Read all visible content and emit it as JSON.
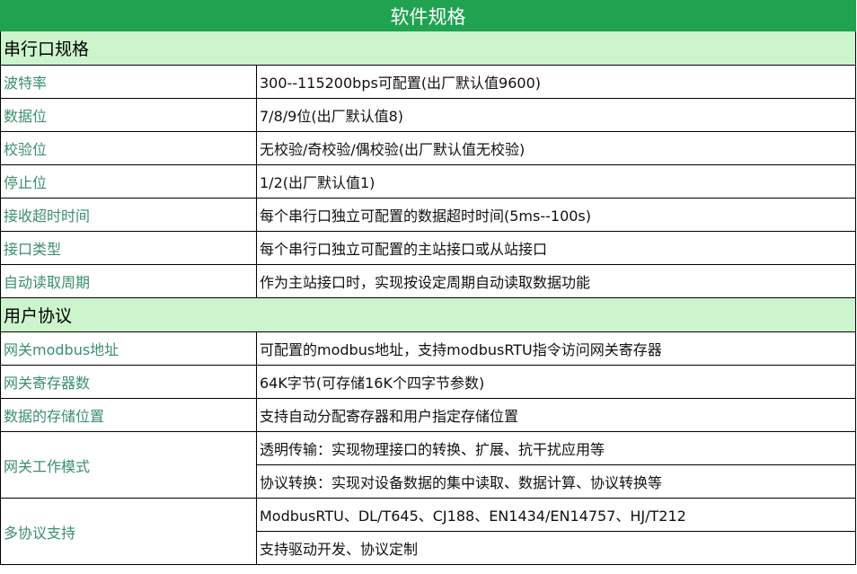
{
  "title": "软件规格",
  "sections": [
    {
      "name": "串行口规格",
      "rows": [
        {
          "label": "波特率",
          "values": [
            "300--115200bps可配置(出厂默认值9600)"
          ]
        },
        {
          "label": "数据位",
          "values": [
            "7/8/9位(出厂默认值8)"
          ]
        },
        {
          "label": "校验位",
          "values": [
            "无校验/奇校验/偶校验(出厂默认值无校验)"
          ]
        },
        {
          "label": "停止位",
          "values": [
            "1/2(出厂默认值1)"
          ]
        },
        {
          "label": "接收超时时间",
          "values": [
            "每个串行口独立可配置的数据超时时间(5ms--100s)"
          ]
        },
        {
          "label": "接口类型",
          "values": [
            "每个串行口独立可配置的主站接口或从站接口"
          ]
        },
        {
          "label": "自动读取周期",
          "values": [
            "作为主站接口时，实现按设定周期自动读取数据功能"
          ]
        }
      ]
    },
    {
      "name": "用户协议",
      "rows": [
        {
          "label": "网关modbus地址",
          "values": [
            "可配置的modbus地址，支持modbusRTU指令访问网关寄存器"
          ]
        },
        {
          "label": "网关寄存器数",
          "values": [
            "64K字节(可存储16K个四字节参数)"
          ]
        },
        {
          "label": "数据的存储位置",
          "values": [
            "支持自动分配寄存器和用户指定存储位置"
          ]
        },
        {
          "label": "网关工作模式",
          "values": [
            "透明传输：实现物理接口的转换、扩展、抗干扰应用等",
            "协议转换：实现对设备数据的集中读取、数据计算、协议转换等"
          ]
        },
        {
          "label": "多协议支持",
          "values": [
            "ModbusRTU、DL/T645、CJ188、EN1434/EN14757、HJ/T212",
            "支持驱动开发、协议定制"
          ]
        }
      ]
    }
  ]
}
